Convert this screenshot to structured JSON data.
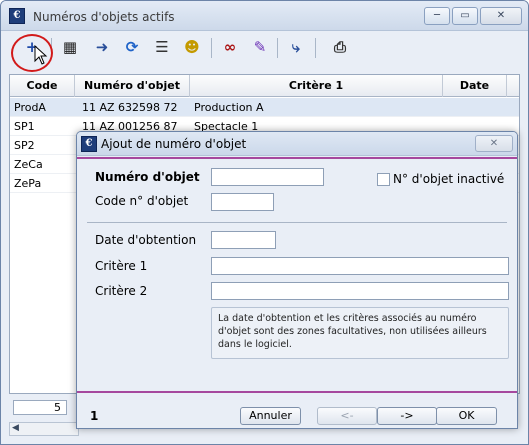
{
  "window": {
    "title": "Numéros d'objets actifs",
    "min_glyph": "─",
    "max_glyph": "▭",
    "close_glyph": "✕",
    "app_icon_text": "€"
  },
  "toolbar": {
    "icons": [
      {
        "name": "add-icon",
        "glyph": "+",
        "color": "#1e4aa8"
      },
      {
        "name": "film-clapper-icon",
        "glyph": "▦",
        "color": "#222"
      },
      {
        "name": "import-icon",
        "glyph": "➜",
        "color": "#2a4f9a"
      },
      {
        "name": "refresh-icon",
        "glyph": "⟳",
        "color": "#1f63c8"
      },
      {
        "name": "list-icon",
        "glyph": "☰",
        "color": "#333"
      },
      {
        "name": "user-badge-icon",
        "glyph": "☻",
        "color": "#c49a00"
      },
      {
        "name": "glasses-icon",
        "glyph": "∞",
        "color": "#a11"
      },
      {
        "name": "pencil-icon",
        "glyph": "✎",
        "color": "#6a2fb5"
      },
      {
        "name": "redirect-icon",
        "glyph": "⤷",
        "color": "#2a4f9a"
      },
      {
        "name": "printer-icon",
        "glyph": "⎙",
        "color": "#333"
      }
    ]
  },
  "grid": {
    "columns": [
      "Code",
      "Numéro d'objet",
      "Critère 1",
      "Date"
    ],
    "rows": [
      {
        "code": "ProdA",
        "numero": "11 AZ 632598 72",
        "critere": "Production A",
        "date": ""
      },
      {
        "code": "SP1",
        "numero": "11 AZ 001256 87",
        "critere": "Spectacle 1",
        "date": ""
      },
      {
        "code": "SP2",
        "numero": "",
        "critere": "",
        "date": ""
      },
      {
        "code": "ZeCa",
        "numero": "",
        "critere": "",
        "date": ""
      },
      {
        "code": "ZePa",
        "numero": "",
        "critere": "",
        "date": ""
      }
    ],
    "count": "5"
  },
  "dialog": {
    "title": "Ajout de numéro d'objet",
    "close_glyph": "✕",
    "numero_label": "Numéro d'objet",
    "numero_value": "",
    "code_label": "Code n° d'objet",
    "code_value": "",
    "inactive_label": "N° d'objet inactivé",
    "date_label": "Date d'obtention",
    "date_value": "",
    "critere1_label": "Critère 1",
    "critere1_value": "",
    "critere2_label": "Critère 2",
    "critere2_value": "",
    "note": "La date d'obtention et les critères associés au numéro d'objet sont des zones facultatives, non utilisées ailleurs dans le logiciel.",
    "page": "1",
    "cancel_label": "Annuler",
    "prev_label": "<-",
    "next_label": "->",
    "ok_label": "OK"
  },
  "colors": {
    "accent_bar": "#a6489e",
    "highlight_circle": "#d21a1a",
    "selected_row": "#dde7f4"
  }
}
